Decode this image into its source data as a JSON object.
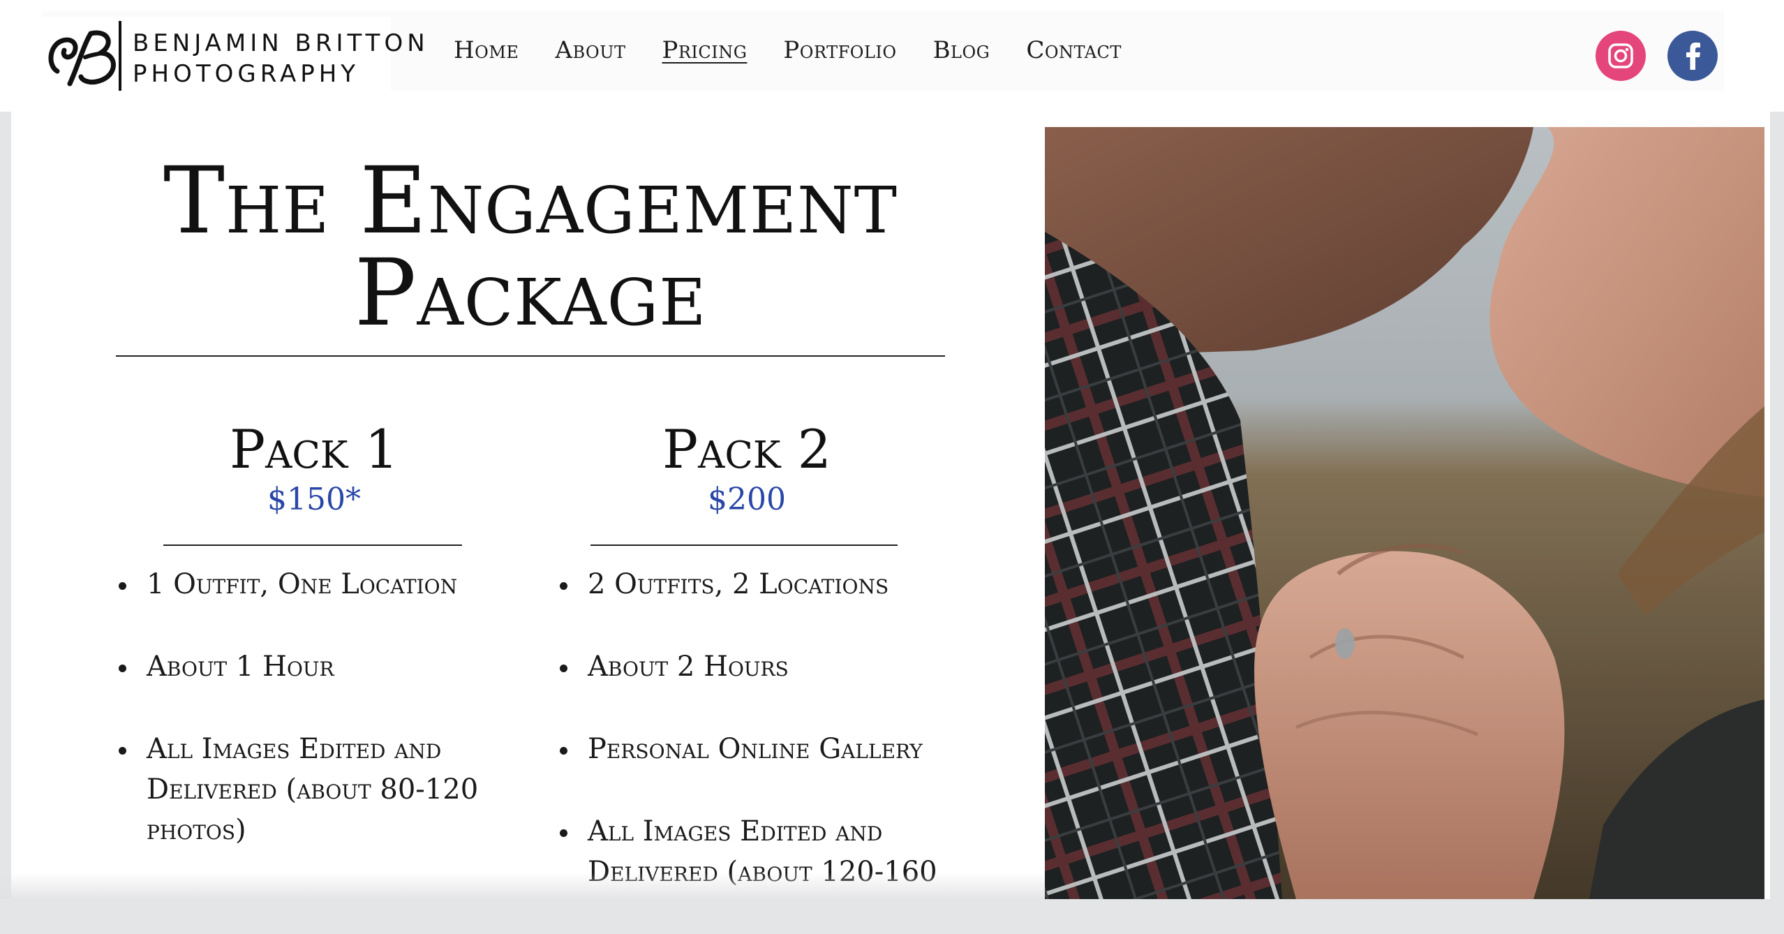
{
  "brand": {
    "name_line1": "BENJAMIN BRITTON",
    "name_line2": "PHOTOGRAPHY",
    "monogram": "BB"
  },
  "nav": {
    "items": [
      {
        "label": "Home"
      },
      {
        "label": "About"
      },
      {
        "label": "Pricing",
        "active": true
      },
      {
        "label": "Portfolio"
      },
      {
        "label": "Blog"
      },
      {
        "label": "Contact"
      }
    ]
  },
  "social": {
    "instagram_icon": "instagram-icon",
    "facebook_icon": "facebook-icon",
    "instagram_color": "#e4467b",
    "facebook_color": "#3b5998"
  },
  "main": {
    "title_line1": "The Engagement",
    "title_line2": "Package",
    "packs": [
      {
        "name": "Pack 1",
        "price": "$150*",
        "features": [
          "1 Outfit, One Location",
          "About 1 Hour",
          "All Images Edited and Delivered (about 80-120 photos)"
        ]
      },
      {
        "name": "Pack 2",
        "price": "$200",
        "features": [
          "2 Outfits, 2 Locations",
          "About 2 Hours",
          "Personal Online Gallery",
          "All Images Edited and Delivered (about 120-160"
        ]
      }
    ],
    "price_color": "#2a47a8"
  },
  "photo": {
    "subject": "engagement-couple-photo"
  }
}
